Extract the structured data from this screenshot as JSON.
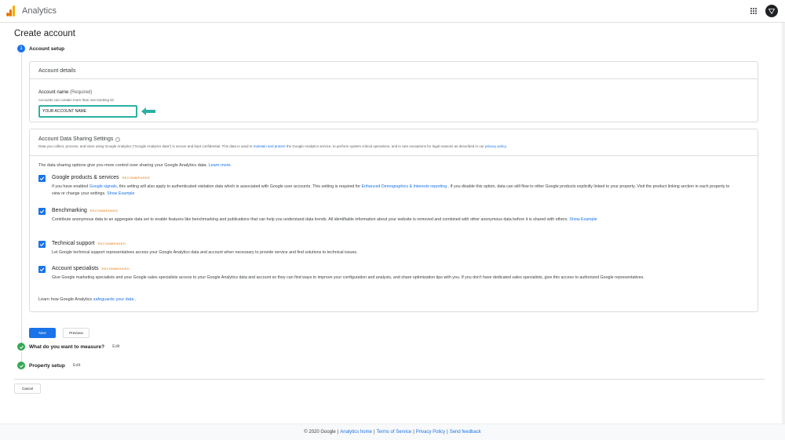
{
  "app": {
    "name": "Analytics"
  },
  "page": {
    "title": "Create account"
  },
  "steps": [
    {
      "num": "1",
      "label": "Account setup"
    },
    {
      "label": "What do you want to measure?",
      "edit": "Edit"
    },
    {
      "label": "Property setup",
      "edit": "Edit"
    }
  ],
  "account_details": {
    "heading": "Account details",
    "name_label": "Account name",
    "name_required": "(Required)",
    "name_hint": "Accounts can contain more than one tracking ID.",
    "name_value": "YOUR ACCOUNT NAME"
  },
  "sharing": {
    "title": "Account Data Sharing Settings",
    "help": "?",
    "desc_pre": "Data you collect, process, and store using Google Analytics (\"Google Analytics data\") is secure and kept confidential. This data is used to",
    "desc_link": "maintain and protect",
    "desc_mid": "the Google Analytics service, to perform system critical operations, and in rare exceptions for legal reasons as described in our",
    "desc_link2": "privacy policy",
    "desc_end": ".",
    "intro": "The data sharing options give you more control over sharing your Google Analytics data.",
    "intro_link": "Learn more.",
    "recommended": "RECOMMENDED",
    "options": [
      {
        "title": "Google products & services",
        "desc_pre": "If you have enabled",
        "link1": "Google signals",
        "desc_mid": ", this setting will also apply to authenticated visitation data which is associated with Google user accounts. This setting is required for",
        "link2": "Enhanced Demographics & Interests reporting",
        "desc_end": ". If you disable this option, data can still flow to other Google products explicitly linked to your property. Visit the product linking section in each property to view or change your settings.",
        "example": "Show Example"
      },
      {
        "title": "Benchmarking",
        "desc": "Contribute anonymous data to an aggregate data set to enable features like benchmarking and publications that can help you understand data trends. All identifiable information about your website is removed and combined with other anonymous data before it is shared with others.",
        "example": "Show Example"
      },
      {
        "title": "Technical support",
        "desc": "Let Google technical support representatives access your Google Analytics data and account when necessary to provide service and find solutions to technical issues."
      },
      {
        "title": "Account specialists",
        "desc": "Give Google marketing specialists and your Google sales specialists access to your Google Analytics data and account so they can find ways to improve your configuration and analysis, and share optimization tips with you. If you don't have dedicated sales specialists, give this access to authorized Google representatives."
      }
    ],
    "foot_pre": "Learn how Google Analytics",
    "foot_link": "safeguards your data",
    "foot_end": "."
  },
  "buttons": {
    "next": "Next",
    "previous": "Previous",
    "cancel": "Cancel"
  },
  "footer": {
    "copyright": "© 2020 Google",
    "links": [
      "Analytics home",
      "Terms of Service",
      "Privacy Policy",
      "Send feedback"
    ],
    "sep": "|"
  },
  "colors": {
    "accent": "#1a73e8",
    "highlight": "#2bb0a2",
    "success": "#34a853",
    "badge": "#e37400"
  },
  "icons": {
    "logo": "analytics-logo-icon",
    "apps": "apps-grid-icon",
    "account": "account-avatar-icon",
    "arrow": "arrow-left-icon",
    "check": "check-icon",
    "help": "help-icon"
  }
}
